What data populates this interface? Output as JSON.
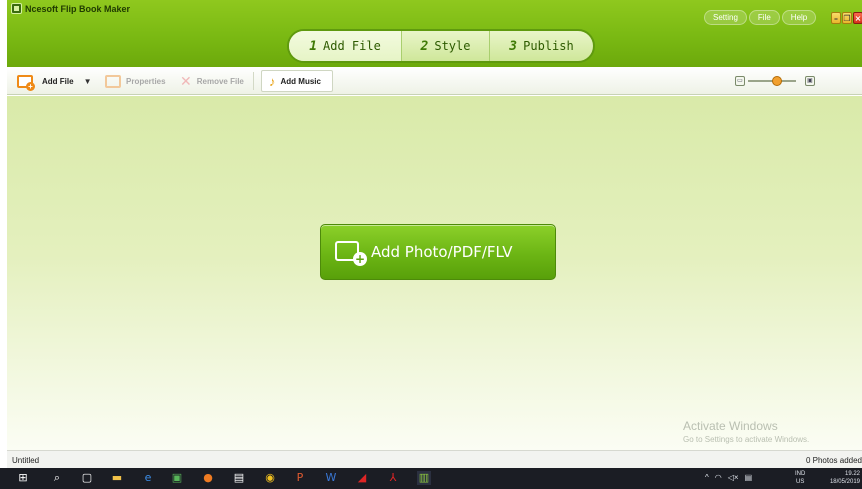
{
  "app": {
    "title": "Ncesoft Flip Book Maker"
  },
  "topmenu": {
    "setting": "Setting",
    "file": "File",
    "help": "Help"
  },
  "window_controls": {
    "minimize": "–",
    "restore": "❐",
    "close": "×"
  },
  "steps": [
    {
      "num": "1",
      "label": "Add File",
      "active": true
    },
    {
      "num": "2",
      "label": "Style"
    },
    {
      "num": "3",
      "label": "Publish"
    }
  ],
  "toolbar": {
    "add_file": "Add File",
    "properties": "Properties",
    "remove_file": "Remove File",
    "add_music": "Add Music",
    "zoom_level": 0.6
  },
  "main": {
    "add_button_label": "Add Photo/PDF/FLV"
  },
  "watermark": {
    "line1": "Activate Windows",
    "line2": "Go to Settings to activate Windows."
  },
  "status": {
    "left": "Untitled",
    "right": "0 Photos added"
  },
  "taskbar": {
    "lang_top": "IND",
    "lang_bottom": "US",
    "time": "19.22",
    "date": "18/05/2019"
  },
  "colors": {
    "accent": "#7ab913",
    "main_bg": "#e4f0be",
    "taskbar": "#1b1d24"
  }
}
